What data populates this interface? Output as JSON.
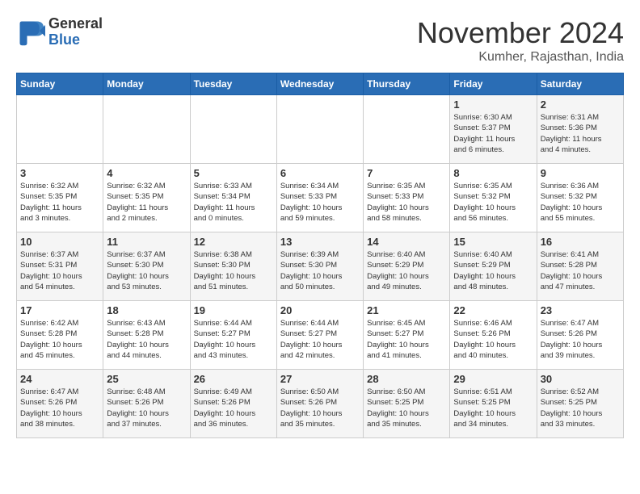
{
  "logo": {
    "general": "General",
    "blue": "Blue"
  },
  "title": "November 2024",
  "location": "Kumher, Rajasthan, India",
  "weekdays": [
    "Sunday",
    "Monday",
    "Tuesday",
    "Wednesday",
    "Thursday",
    "Friday",
    "Saturday"
  ],
  "weeks": [
    [
      {
        "day": "",
        "info": ""
      },
      {
        "day": "",
        "info": ""
      },
      {
        "day": "",
        "info": ""
      },
      {
        "day": "",
        "info": ""
      },
      {
        "day": "",
        "info": ""
      },
      {
        "day": "1",
        "info": "Sunrise: 6:30 AM\nSunset: 5:37 PM\nDaylight: 11 hours\nand 6 minutes."
      },
      {
        "day": "2",
        "info": "Sunrise: 6:31 AM\nSunset: 5:36 PM\nDaylight: 11 hours\nand 4 minutes."
      }
    ],
    [
      {
        "day": "3",
        "info": "Sunrise: 6:32 AM\nSunset: 5:35 PM\nDaylight: 11 hours\nand 3 minutes."
      },
      {
        "day": "4",
        "info": "Sunrise: 6:32 AM\nSunset: 5:35 PM\nDaylight: 11 hours\nand 2 minutes."
      },
      {
        "day": "5",
        "info": "Sunrise: 6:33 AM\nSunset: 5:34 PM\nDaylight: 11 hours\nand 0 minutes."
      },
      {
        "day": "6",
        "info": "Sunrise: 6:34 AM\nSunset: 5:33 PM\nDaylight: 10 hours\nand 59 minutes."
      },
      {
        "day": "7",
        "info": "Sunrise: 6:35 AM\nSunset: 5:33 PM\nDaylight: 10 hours\nand 58 minutes."
      },
      {
        "day": "8",
        "info": "Sunrise: 6:35 AM\nSunset: 5:32 PM\nDaylight: 10 hours\nand 56 minutes."
      },
      {
        "day": "9",
        "info": "Sunrise: 6:36 AM\nSunset: 5:32 PM\nDaylight: 10 hours\nand 55 minutes."
      }
    ],
    [
      {
        "day": "10",
        "info": "Sunrise: 6:37 AM\nSunset: 5:31 PM\nDaylight: 10 hours\nand 54 minutes."
      },
      {
        "day": "11",
        "info": "Sunrise: 6:37 AM\nSunset: 5:30 PM\nDaylight: 10 hours\nand 53 minutes."
      },
      {
        "day": "12",
        "info": "Sunrise: 6:38 AM\nSunset: 5:30 PM\nDaylight: 10 hours\nand 51 minutes."
      },
      {
        "day": "13",
        "info": "Sunrise: 6:39 AM\nSunset: 5:30 PM\nDaylight: 10 hours\nand 50 minutes."
      },
      {
        "day": "14",
        "info": "Sunrise: 6:40 AM\nSunset: 5:29 PM\nDaylight: 10 hours\nand 49 minutes."
      },
      {
        "day": "15",
        "info": "Sunrise: 6:40 AM\nSunset: 5:29 PM\nDaylight: 10 hours\nand 48 minutes."
      },
      {
        "day": "16",
        "info": "Sunrise: 6:41 AM\nSunset: 5:28 PM\nDaylight: 10 hours\nand 47 minutes."
      }
    ],
    [
      {
        "day": "17",
        "info": "Sunrise: 6:42 AM\nSunset: 5:28 PM\nDaylight: 10 hours\nand 45 minutes."
      },
      {
        "day": "18",
        "info": "Sunrise: 6:43 AM\nSunset: 5:28 PM\nDaylight: 10 hours\nand 44 minutes."
      },
      {
        "day": "19",
        "info": "Sunrise: 6:44 AM\nSunset: 5:27 PM\nDaylight: 10 hours\nand 43 minutes."
      },
      {
        "day": "20",
        "info": "Sunrise: 6:44 AM\nSunset: 5:27 PM\nDaylight: 10 hours\nand 42 minutes."
      },
      {
        "day": "21",
        "info": "Sunrise: 6:45 AM\nSunset: 5:27 PM\nDaylight: 10 hours\nand 41 minutes."
      },
      {
        "day": "22",
        "info": "Sunrise: 6:46 AM\nSunset: 5:26 PM\nDaylight: 10 hours\nand 40 minutes."
      },
      {
        "day": "23",
        "info": "Sunrise: 6:47 AM\nSunset: 5:26 PM\nDaylight: 10 hours\nand 39 minutes."
      }
    ],
    [
      {
        "day": "24",
        "info": "Sunrise: 6:47 AM\nSunset: 5:26 PM\nDaylight: 10 hours\nand 38 minutes."
      },
      {
        "day": "25",
        "info": "Sunrise: 6:48 AM\nSunset: 5:26 PM\nDaylight: 10 hours\nand 37 minutes."
      },
      {
        "day": "26",
        "info": "Sunrise: 6:49 AM\nSunset: 5:26 PM\nDaylight: 10 hours\nand 36 minutes."
      },
      {
        "day": "27",
        "info": "Sunrise: 6:50 AM\nSunset: 5:26 PM\nDaylight: 10 hours\nand 35 minutes."
      },
      {
        "day": "28",
        "info": "Sunrise: 6:50 AM\nSunset: 5:25 PM\nDaylight: 10 hours\nand 35 minutes."
      },
      {
        "day": "29",
        "info": "Sunrise: 6:51 AM\nSunset: 5:25 PM\nDaylight: 10 hours\nand 34 minutes."
      },
      {
        "day": "30",
        "info": "Sunrise: 6:52 AM\nSunset: 5:25 PM\nDaylight: 10 hours\nand 33 minutes."
      }
    ]
  ]
}
